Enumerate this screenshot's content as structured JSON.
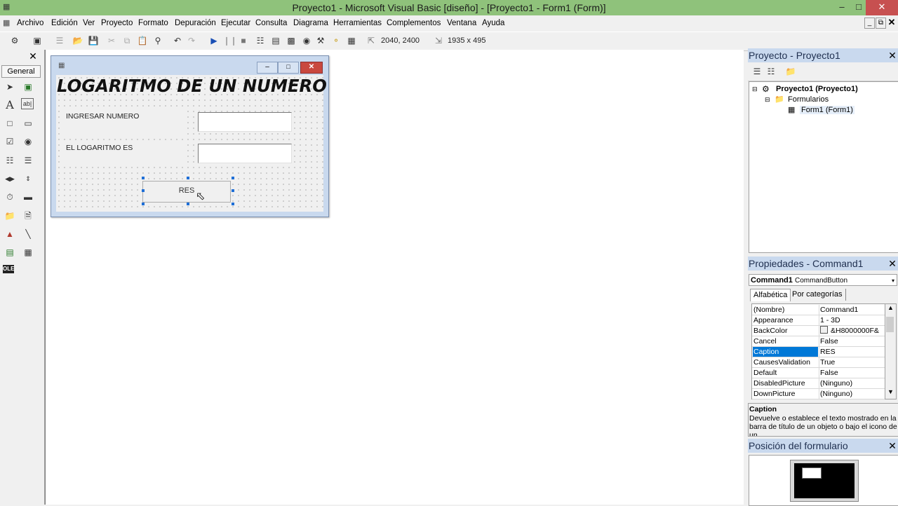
{
  "window": {
    "title": "Proyecto1 - Microsoft Visual Basic [diseño] - [Proyecto1 - Form1 (Form)]",
    "minimize": "–",
    "restore": "□",
    "close": "✕"
  },
  "menu": [
    "Archivo",
    "Edición",
    "Ver",
    "Proyecto",
    "Formato",
    "Depuración",
    "Ejecutar",
    "Consulta",
    "Diagrama",
    "Herramientas",
    "Complementos",
    "Ventana",
    "Ayuda"
  ],
  "toolbar": {
    "position": "2040, 2400",
    "size": "1935 x 495"
  },
  "toolbox": {
    "close": "✕",
    "tab_label": "General",
    "label_glyph": "A",
    "textbox_glyph": "ab|",
    "ole_glyph": "OLE"
  },
  "form": {
    "heading": "LOGARITMO DE UN NUMERO",
    "label_input": "INGRESAR NUMERO",
    "label_result": "EL LOGARITMO ES",
    "button_caption": "RES"
  },
  "project_pane": {
    "title": "Proyecto - Proyecto1",
    "close": "✕",
    "tree": {
      "root": "Proyecto1 (Proyecto1)",
      "folder": "Formularios",
      "item": "Form1 (Form1)"
    }
  },
  "properties_pane": {
    "title": "Propiedades - Command1",
    "close": "✕",
    "object_name": "Command1",
    "object_type": "CommandButton",
    "tab_alpha": "Alfabética",
    "tab_category": "Por categorías",
    "rows": [
      {
        "name": "(Nombre)",
        "value": "Command1"
      },
      {
        "name": "Appearance",
        "value": "1 - 3D"
      },
      {
        "name": "BackColor",
        "value": "&H8000000F&"
      },
      {
        "name": "Cancel",
        "value": "False"
      },
      {
        "name": "Caption",
        "value": "RES"
      },
      {
        "name": "CausesValidation",
        "value": "True"
      },
      {
        "name": "Default",
        "value": "False"
      },
      {
        "name": "DisabledPicture",
        "value": "(Ninguno)"
      },
      {
        "name": "DownPicture",
        "value": "(Ninguno)"
      }
    ],
    "selected_row": 4,
    "desc_title": "Caption",
    "desc_text": "Devuelve o establece el texto mostrado en la barra de título de un objeto o bajo el icono de un"
  },
  "position_pane": {
    "title": "Posición del formulario",
    "close": "✕"
  },
  "colors": {
    "titlebar": "#8fc27b",
    "pane_title": "#c9d9ee",
    "selection": "#0078d7",
    "handle": "#1f6fd6"
  }
}
